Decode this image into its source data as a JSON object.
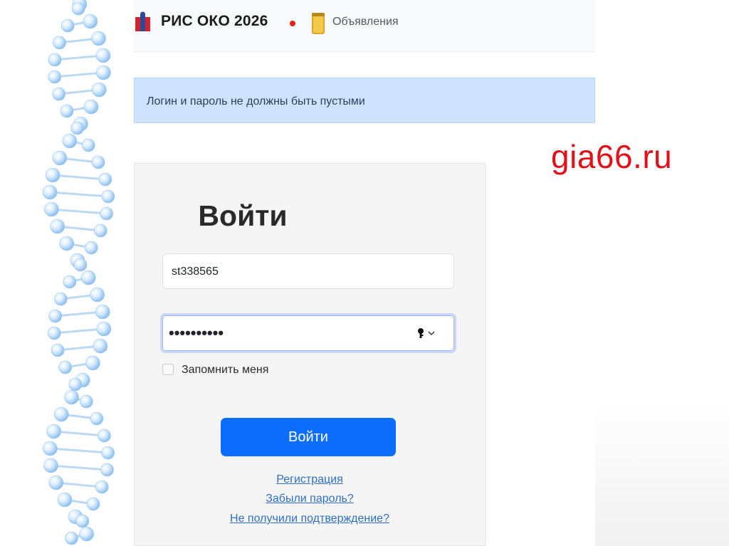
{
  "header": {
    "brand": "РИС ОКО 2026",
    "announcements_label": "Объявления",
    "icons": [
      "brand-logo-icon",
      "status-dot-icon",
      "notes-icon"
    ]
  },
  "alert": {
    "message": "Логин и пароль не должны быть пустыми"
  },
  "watermark": "gia66.ru",
  "login_form": {
    "title": "Войти",
    "login_value": "st338565",
    "password_display": "••••••••••",
    "remember_label": "Запомнить меня",
    "remember_checked": false,
    "submit_label": "Войти",
    "links": {
      "register": "Регистрация",
      "forgot_password": "Забыли пароль?",
      "no_confirmation": "Не получили подтверждение?"
    }
  },
  "colors": {
    "primary": "#0d6efd",
    "alert_bg": "#cfe2ff",
    "watermark": "#e1111a",
    "link": "#2f6fc2"
  }
}
